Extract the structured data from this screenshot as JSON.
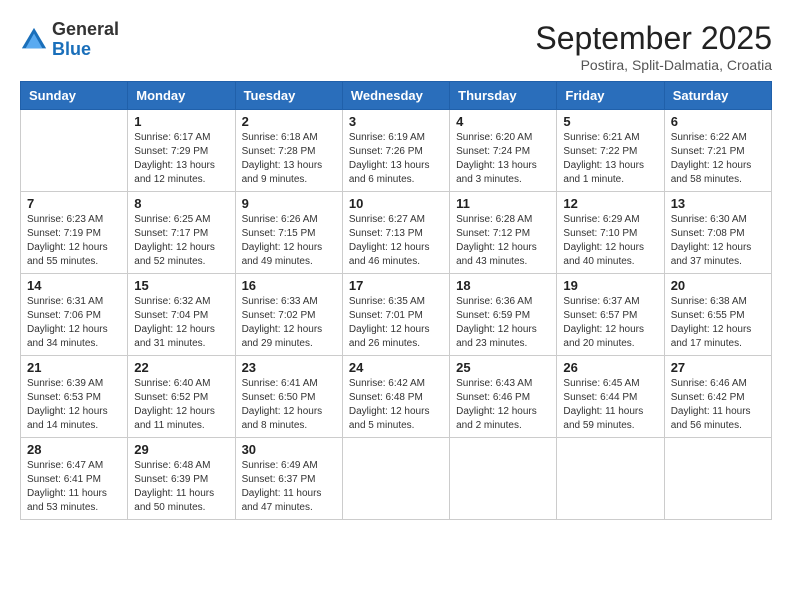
{
  "logo": {
    "text_general": "General",
    "text_blue": "Blue"
  },
  "header": {
    "month": "September 2025",
    "location": "Postira, Split-Dalmatia, Croatia"
  },
  "weekdays": [
    "Sunday",
    "Monday",
    "Tuesday",
    "Wednesday",
    "Thursday",
    "Friday",
    "Saturday"
  ],
  "weeks": [
    [
      {
        "day": "",
        "info": ""
      },
      {
        "day": "1",
        "info": "Sunrise: 6:17 AM\nSunset: 7:29 PM\nDaylight: 13 hours\nand 12 minutes."
      },
      {
        "day": "2",
        "info": "Sunrise: 6:18 AM\nSunset: 7:28 PM\nDaylight: 13 hours\nand 9 minutes."
      },
      {
        "day": "3",
        "info": "Sunrise: 6:19 AM\nSunset: 7:26 PM\nDaylight: 13 hours\nand 6 minutes."
      },
      {
        "day": "4",
        "info": "Sunrise: 6:20 AM\nSunset: 7:24 PM\nDaylight: 13 hours\nand 3 minutes."
      },
      {
        "day": "5",
        "info": "Sunrise: 6:21 AM\nSunset: 7:22 PM\nDaylight: 13 hours\nand 1 minute."
      },
      {
        "day": "6",
        "info": "Sunrise: 6:22 AM\nSunset: 7:21 PM\nDaylight: 12 hours\nand 58 minutes."
      }
    ],
    [
      {
        "day": "7",
        "info": "Sunrise: 6:23 AM\nSunset: 7:19 PM\nDaylight: 12 hours\nand 55 minutes."
      },
      {
        "day": "8",
        "info": "Sunrise: 6:25 AM\nSunset: 7:17 PM\nDaylight: 12 hours\nand 52 minutes."
      },
      {
        "day": "9",
        "info": "Sunrise: 6:26 AM\nSunset: 7:15 PM\nDaylight: 12 hours\nand 49 minutes."
      },
      {
        "day": "10",
        "info": "Sunrise: 6:27 AM\nSunset: 7:13 PM\nDaylight: 12 hours\nand 46 minutes."
      },
      {
        "day": "11",
        "info": "Sunrise: 6:28 AM\nSunset: 7:12 PM\nDaylight: 12 hours\nand 43 minutes."
      },
      {
        "day": "12",
        "info": "Sunrise: 6:29 AM\nSunset: 7:10 PM\nDaylight: 12 hours\nand 40 minutes."
      },
      {
        "day": "13",
        "info": "Sunrise: 6:30 AM\nSunset: 7:08 PM\nDaylight: 12 hours\nand 37 minutes."
      }
    ],
    [
      {
        "day": "14",
        "info": "Sunrise: 6:31 AM\nSunset: 7:06 PM\nDaylight: 12 hours\nand 34 minutes."
      },
      {
        "day": "15",
        "info": "Sunrise: 6:32 AM\nSunset: 7:04 PM\nDaylight: 12 hours\nand 31 minutes."
      },
      {
        "day": "16",
        "info": "Sunrise: 6:33 AM\nSunset: 7:02 PM\nDaylight: 12 hours\nand 29 minutes."
      },
      {
        "day": "17",
        "info": "Sunrise: 6:35 AM\nSunset: 7:01 PM\nDaylight: 12 hours\nand 26 minutes."
      },
      {
        "day": "18",
        "info": "Sunrise: 6:36 AM\nSunset: 6:59 PM\nDaylight: 12 hours\nand 23 minutes."
      },
      {
        "day": "19",
        "info": "Sunrise: 6:37 AM\nSunset: 6:57 PM\nDaylight: 12 hours\nand 20 minutes."
      },
      {
        "day": "20",
        "info": "Sunrise: 6:38 AM\nSunset: 6:55 PM\nDaylight: 12 hours\nand 17 minutes."
      }
    ],
    [
      {
        "day": "21",
        "info": "Sunrise: 6:39 AM\nSunset: 6:53 PM\nDaylight: 12 hours\nand 14 minutes."
      },
      {
        "day": "22",
        "info": "Sunrise: 6:40 AM\nSunset: 6:52 PM\nDaylight: 12 hours\nand 11 minutes."
      },
      {
        "day": "23",
        "info": "Sunrise: 6:41 AM\nSunset: 6:50 PM\nDaylight: 12 hours\nand 8 minutes."
      },
      {
        "day": "24",
        "info": "Sunrise: 6:42 AM\nSunset: 6:48 PM\nDaylight: 12 hours\nand 5 minutes."
      },
      {
        "day": "25",
        "info": "Sunrise: 6:43 AM\nSunset: 6:46 PM\nDaylight: 12 hours\nand 2 minutes."
      },
      {
        "day": "26",
        "info": "Sunrise: 6:45 AM\nSunset: 6:44 PM\nDaylight: 11 hours\nand 59 minutes."
      },
      {
        "day": "27",
        "info": "Sunrise: 6:46 AM\nSunset: 6:42 PM\nDaylight: 11 hours\nand 56 minutes."
      }
    ],
    [
      {
        "day": "28",
        "info": "Sunrise: 6:47 AM\nSunset: 6:41 PM\nDaylight: 11 hours\nand 53 minutes."
      },
      {
        "day": "29",
        "info": "Sunrise: 6:48 AM\nSunset: 6:39 PM\nDaylight: 11 hours\nand 50 minutes."
      },
      {
        "day": "30",
        "info": "Sunrise: 6:49 AM\nSunset: 6:37 PM\nDaylight: 11 hours\nand 47 minutes."
      },
      {
        "day": "",
        "info": ""
      },
      {
        "day": "",
        "info": ""
      },
      {
        "day": "",
        "info": ""
      },
      {
        "day": "",
        "info": ""
      }
    ]
  ]
}
